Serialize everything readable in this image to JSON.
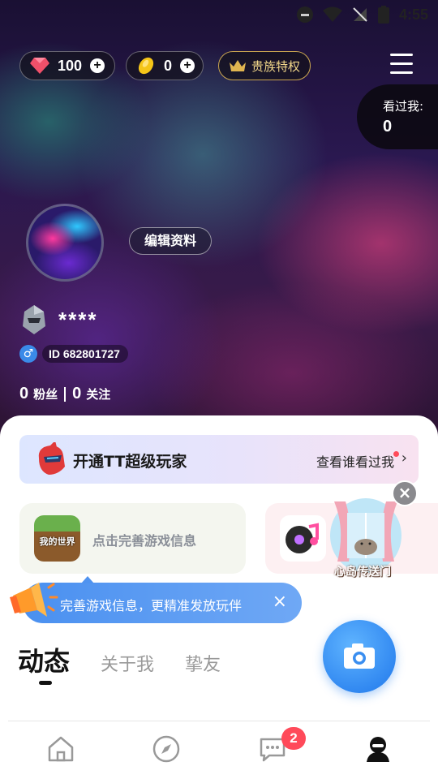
{
  "status_bar": {
    "time": "4:55"
  },
  "currency": {
    "gems": "100",
    "beans": "0",
    "noble_label": "贵族特权"
  },
  "viewed_me": {
    "label": "看过我:",
    "count": "0"
  },
  "profile": {
    "edit_label": "编辑资料",
    "username": "****",
    "id_text": "ID 682801727",
    "gender_symbol": "♂",
    "fans_count": "0",
    "fans_label": "粉丝",
    "following_count": "0",
    "following_label": "关注"
  },
  "vip_banner": {
    "label": "开通TT超级玩家",
    "link": "查看谁看过我"
  },
  "game_card": {
    "text": "点击完善游戏信息",
    "icon_text": "我的世界"
  },
  "portal": {
    "text": "心岛传送门"
  },
  "tip": {
    "text": "完善游戏信息，更精准发放玩伴"
  },
  "tabs": {
    "active": "动态",
    "about": "关于我",
    "friends": "挚友"
  },
  "bottom_nav": {
    "messages_badge": "2"
  },
  "colors": {
    "accent": "#3a8ae8",
    "badge": "#ff4a5a",
    "noble_gold": "#c9a550"
  }
}
